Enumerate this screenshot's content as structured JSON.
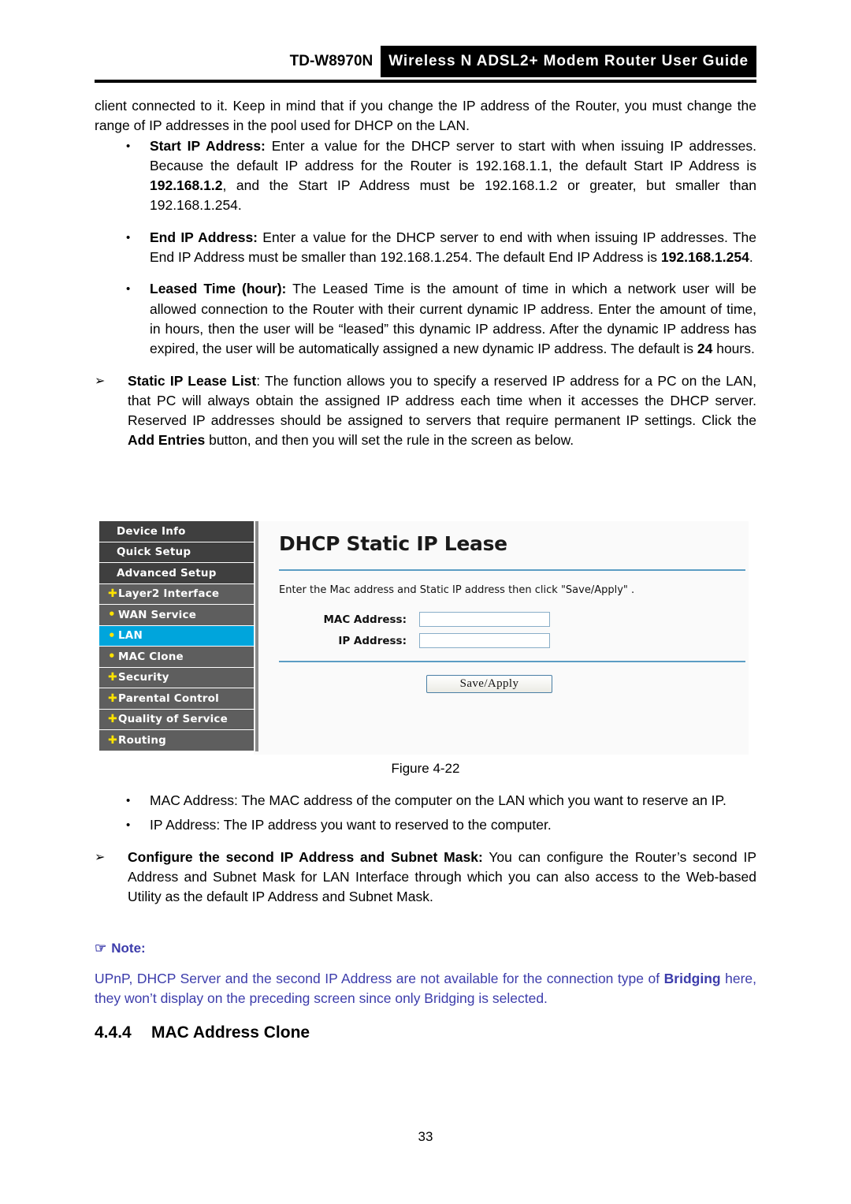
{
  "header": {
    "model": "TD-W8970N",
    "banner_title": "Wireless N ADSL2+ Modem Router User Guide"
  },
  "body": {
    "intro_paragraph": "client connected to it. Keep in mind that if you change the IP address of the Router, you must change the range of IP addresses in the pool used for DHCP on the LAN.",
    "bullets": [
      {
        "marker": "•",
        "term": "Start IP Address:",
        "text": " Enter a value for the DHCP server to start with when issuing IP addresses. Because the default IP address for the Router is 192.168.1.1, the default Start IP Address is ",
        "bold_value": "192.168.1.2",
        "text_tail": ", and the Start IP Address must be 192.168.1.2 or greater, but smaller than 192.168.1.254."
      },
      {
        "marker": "•",
        "term": "End IP Address:",
        "text": " Enter a value for the DHCP server to end with when issuing IP addresses. The End IP Address must be smaller than 192.168.1.254. The default End IP Address is ",
        "bold_value": "192.168.1.254",
        "text_tail": "."
      },
      {
        "marker": "•",
        "term": "Leased Time (hour):",
        "text": " The Leased Time is the amount of time in which a network user will be allowed connection to the Router with their current dynamic IP address. Enter the amount of time, in hours, then the user will be “leased” this dynamic IP address. After the dynamic IP address has expired, the user will be automatically assigned a new dynamic IP address. The default is ",
        "bold_value": "24",
        "text_tail": " hours."
      }
    ],
    "arrow_item_1": {
      "marker": "➢",
      "term": "Static IP Lease List",
      "text_a": ": The function allows you to specify a reserved IP address for a PC on the LAN, that PC will always obtain the assigned IP address each time when it accesses the DHCP server. Reserved IP addresses should be assigned to servers that require permanent IP settings. Click the ",
      "bold_value": "Add Entries",
      "text_b": " button, and then you will set the rule in the screen as below."
    },
    "lower_bullets": [
      {
        "marker": "•",
        "text": "MAC Address: The MAC address of the computer on the LAN which you want to reserve an IP."
      },
      {
        "marker": "•",
        "text": "IP Address: The IP address you want to reserved to the computer."
      }
    ],
    "arrow_item_2": {
      "marker": "➢",
      "term": "Configure the second IP Address and Subnet Mask:",
      "text": " You can configure the Router’s second IP Address and Subnet Mask for LAN Interface through which you can also access to the Web-based Utility as the default IP Address and Subnet Mask."
    }
  },
  "figure": {
    "caption": "Figure 4-22",
    "sidebar": {
      "items": [
        {
          "label": "Device Info",
          "marker": "",
          "style": "top",
          "active": false
        },
        {
          "label": "Quick Setup",
          "marker": "",
          "style": "top",
          "active": false
        },
        {
          "label": "Advanced Setup",
          "marker": "",
          "style": "top",
          "active": false
        },
        {
          "label": "Layer2 Interface",
          "marker": "✚",
          "style": "sub",
          "active": false
        },
        {
          "label": "WAN Service",
          "marker": "•",
          "style": "sub",
          "active": false
        },
        {
          "label": "LAN",
          "marker": "•",
          "style": "sub",
          "active": true
        },
        {
          "label": "MAC Clone",
          "marker": "•",
          "style": "sub",
          "active": false
        },
        {
          "label": "Security",
          "marker": "✚",
          "style": "sub",
          "active": false
        },
        {
          "label": "Parental Control",
          "marker": "✚",
          "style": "sub",
          "active": false
        },
        {
          "label": "Quality of Service",
          "marker": "✚",
          "style": "sub",
          "active": false
        },
        {
          "label": "Routing",
          "marker": "✚",
          "style": "sub",
          "active": false
        }
      ],
      "active_color": "#00a5dc",
      "item_color": "#5e5e5e",
      "top_item_color": "#3f3f3f",
      "marker_color": "#ffe300"
    },
    "main": {
      "title": "DHCP Static IP Lease",
      "description": "Enter the Mac address and Static IP address then click \"Save/Apply\" .",
      "fields": [
        {
          "label": "MAC Address:",
          "value": "",
          "placeholder": ""
        },
        {
          "label": "IP Address:",
          "value": "",
          "placeholder": ""
        }
      ],
      "save_button": "Save/Apply",
      "divider_color": "#5b9dc4"
    }
  },
  "note": {
    "icon": "☞",
    "title": "Note:",
    "text_a": "UPnP, DHCP Server and the second IP Address are not available for the connection type of ",
    "bold_value": "Bridging",
    "text_b": " here, they won’t display on the preceding screen since only Bridging is selected.",
    "color": "#3c3cab"
  },
  "section": {
    "number": "4.4.4",
    "title": "MAC Address Clone"
  },
  "footer": {
    "page_number": "33"
  }
}
